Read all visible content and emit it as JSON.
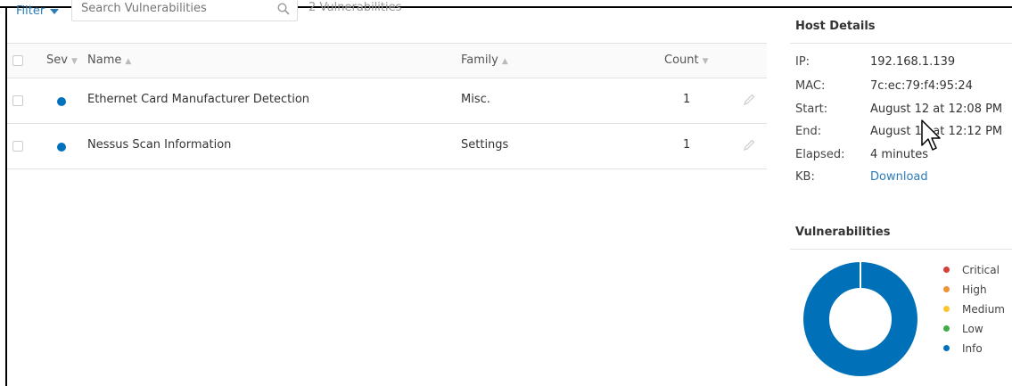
{
  "toolbar": {
    "filter_label": "Filter",
    "search_placeholder": "Search Vulnerabilities",
    "vuln_count": "2 Vulnerabilities"
  },
  "table": {
    "headers": {
      "sev": "Sev",
      "name": "Name",
      "family": "Family",
      "count": "Count"
    },
    "rows": [
      {
        "severity": "Info",
        "name": "Ethernet Card Manufacturer Detection",
        "family": "Misc.",
        "count": "1"
      },
      {
        "severity": "Info",
        "name": "Nessus Scan Information",
        "family": "Settings",
        "count": "1"
      }
    ]
  },
  "host_details": {
    "title": "Host Details",
    "ip_label": "IP:",
    "ip": "192.168.1.139",
    "mac_label": "MAC:",
    "mac": "7c:ec:79:f4:95:24",
    "start_label": "Start:",
    "start": "August 12 at 12:08 PM",
    "end_label": "End:",
    "end": "August 12 at 12:12 PM",
    "elapsed_label": "Elapsed:",
    "elapsed": "4 minutes",
    "kb_label": "KB:",
    "kb": "Download"
  },
  "vulnerabilities": {
    "title": "Vulnerabilities",
    "legend": [
      {
        "label": "Critical",
        "color": "#d43f3a"
      },
      {
        "label": "High",
        "color": "#ee9336"
      },
      {
        "label": "Medium",
        "color": "#fdc431"
      },
      {
        "label": "Low",
        "color": "#3fae49"
      },
      {
        "label": "Info",
        "color": "#0071b9"
      }
    ],
    "counts": {
      "Critical": 0,
      "High": 0,
      "Medium": 0,
      "Low": 0,
      "Info": 2
    }
  },
  "colors": {
    "accent": "#2b7bb9",
    "info": "#0071bc",
    "border": "#e2e2e2"
  }
}
